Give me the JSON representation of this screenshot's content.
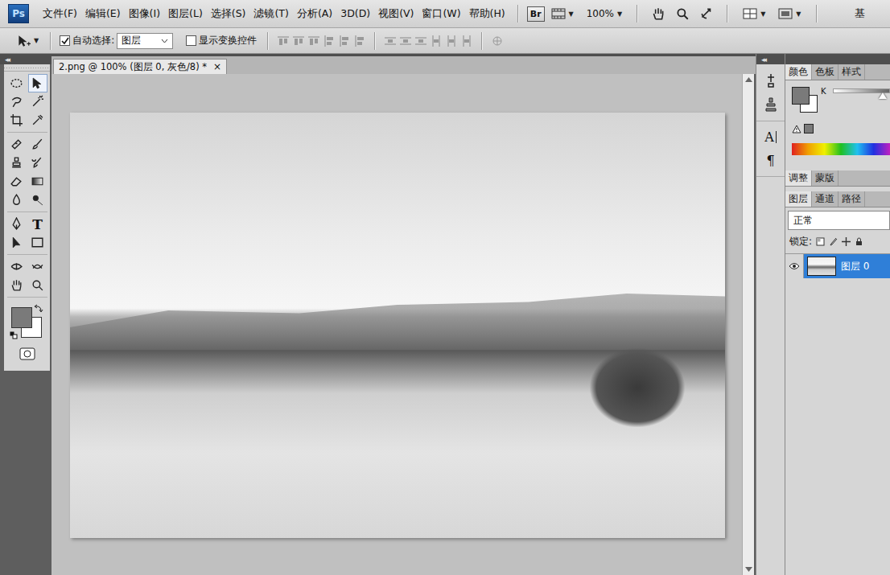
{
  "app": {
    "logo": "Ps"
  },
  "menu": [
    "文件(F)",
    "编辑(E)",
    "图像(I)",
    "图层(L)",
    "选择(S)",
    "滤镜(T)",
    "分析(A)",
    "3D(D)",
    "视图(V)",
    "窗口(W)",
    "帮助(H)"
  ],
  "app_bar": {
    "bridge": "Br",
    "zoom": "100%",
    "dropdown_arrow": "▼",
    "workspace": "基"
  },
  "options_bar": {
    "auto_select": {
      "label": "自动选择:",
      "checked": true
    },
    "auto_select_target": "图层",
    "show_transform": {
      "label": "显示变换控件",
      "checked": false
    }
  },
  "panel_collapse": "◂◂",
  "toolbox": {
    "type_tool": "T"
  },
  "document": {
    "tab": "2.png @ 100% (图层 0, 灰色/8) *",
    "close": "×"
  },
  "dock": {
    "character": "A",
    "paragraph": "¶"
  },
  "color_panel": {
    "tabs": [
      {
        "label": "颜色",
        "selected": true
      },
      {
        "label": "色板",
        "selected": false
      },
      {
        "label": "样式",
        "selected": false
      }
    ],
    "channel": "K",
    "level": 0.87
  },
  "adjust_tabs": [
    {
      "label": "调整",
      "selected": true
    },
    {
      "label": "蒙版",
      "selected": false
    }
  ],
  "layers_panel": {
    "tabs": [
      {
        "label": "图层",
        "selected": true
      },
      {
        "label": "通道",
        "selected": false
      },
      {
        "label": "路径",
        "selected": false
      }
    ],
    "blend_mode": "正常",
    "lock_label": "锁定:",
    "layers": [
      {
        "name": "图层 0",
        "visible": true,
        "selected": true
      }
    ]
  }
}
